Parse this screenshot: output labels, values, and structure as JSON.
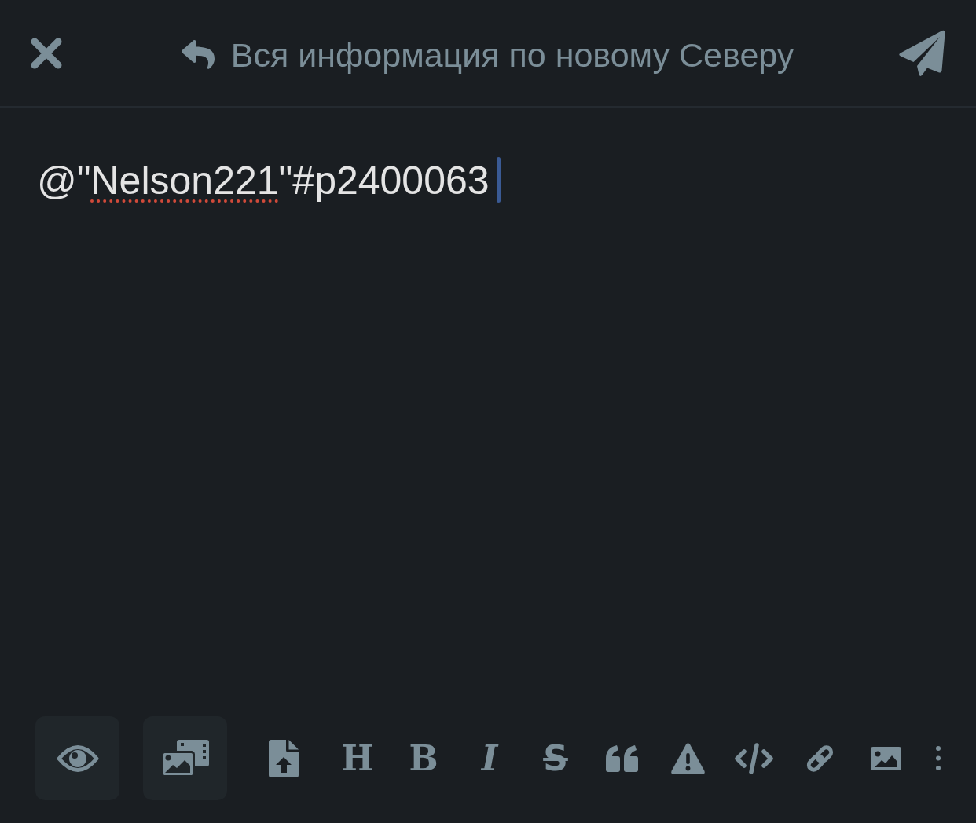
{
  "header": {
    "title": "Вся информация по новому Северу"
  },
  "editor": {
    "focused": true,
    "segments": [
      {
        "text": "@\"",
        "misspelled": false
      },
      {
        "text": "Nelson221",
        "misspelled": true
      },
      {
        "text": "\"#p2400063",
        "misspelled": false
      }
    ]
  },
  "toolbar": {
    "buttons": [
      {
        "kind": "boxed"
      },
      {
        "kind": "boxed"
      },
      {
        "kind": "icon"
      },
      {
        "kind": "letter",
        "label": "H"
      },
      {
        "kind": "letter",
        "label": "B"
      },
      {
        "kind": "letter",
        "label": "I"
      },
      {
        "kind": "letter",
        "label": "S"
      },
      {
        "kind": "icon"
      },
      {
        "kind": "icon"
      },
      {
        "kind": "icon"
      },
      {
        "kind": "icon"
      },
      {
        "kind": "icon"
      },
      {
        "kind": "icon"
      }
    ]
  }
}
